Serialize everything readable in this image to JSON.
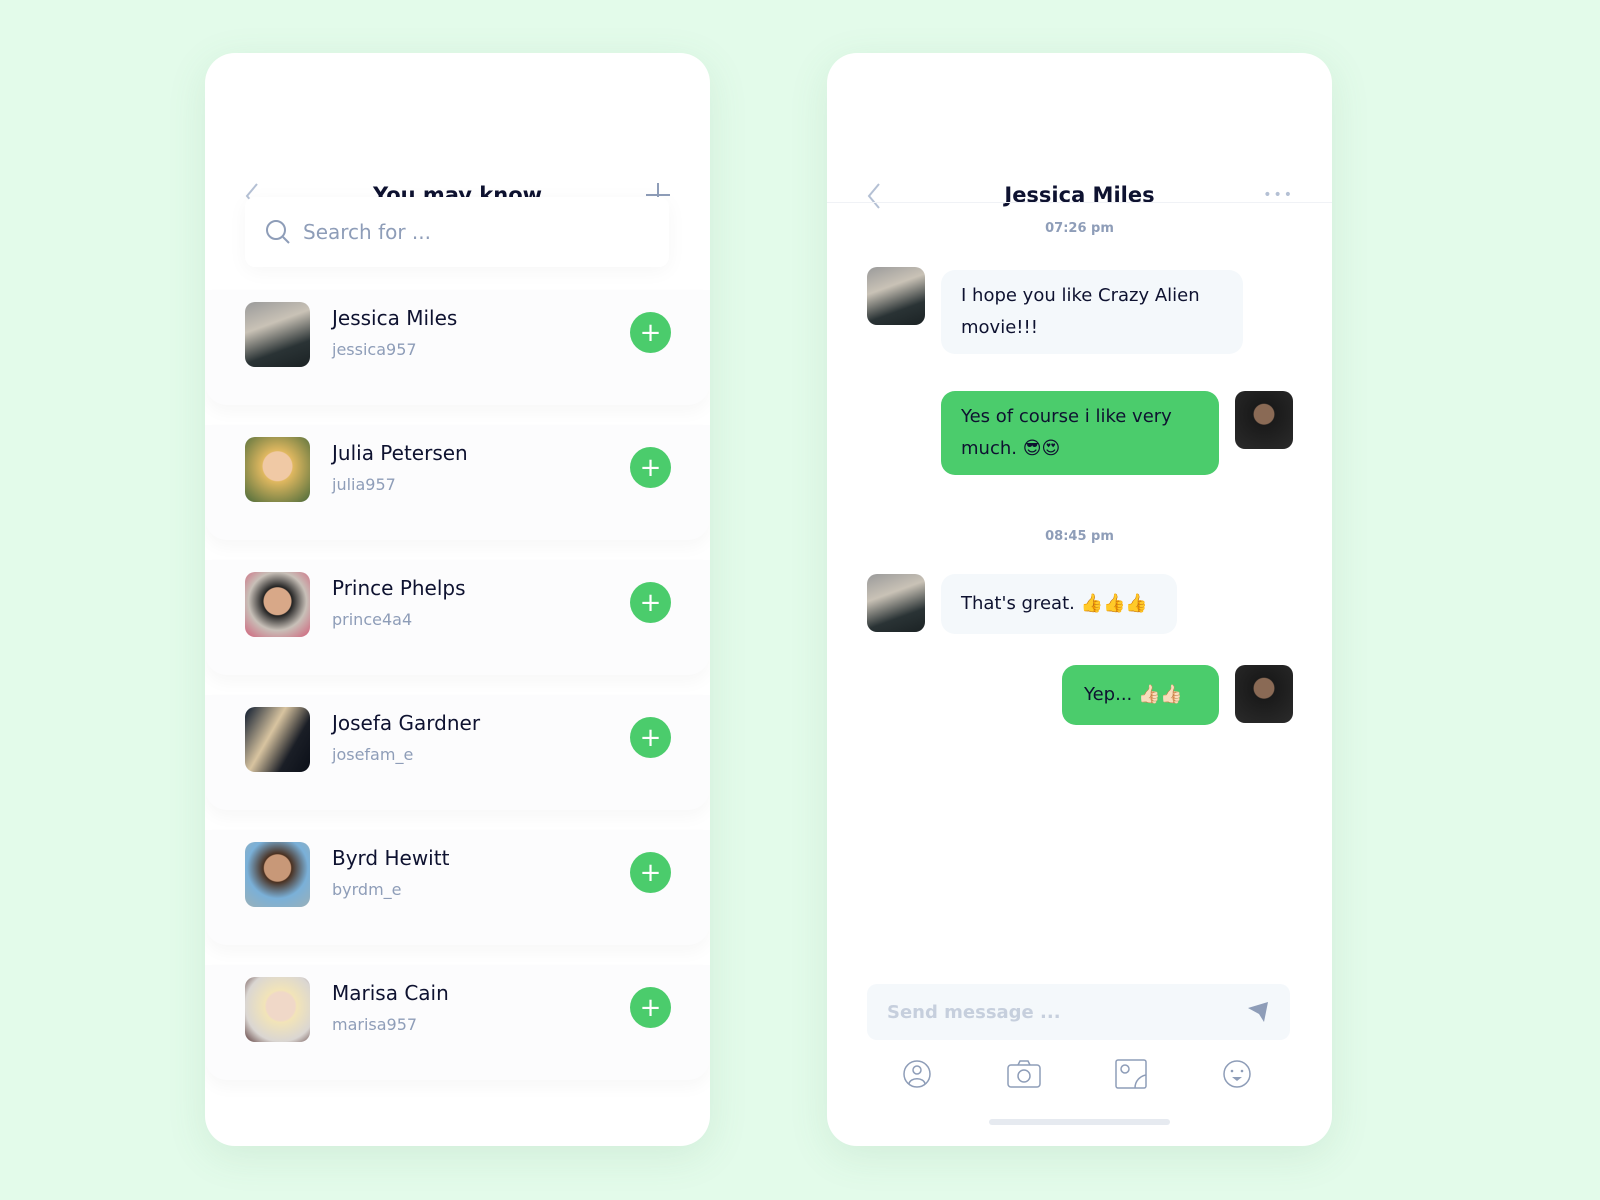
{
  "contacts_screen": {
    "title": "You may know",
    "search_placeholder": "Search for ...",
    "contacts": [
      {
        "name": "Jessica Miles",
        "username": "jessica957"
      },
      {
        "name": "Julia Petersen",
        "username": "julia957"
      },
      {
        "name": "Prince Phelps",
        "username": "prince4a4"
      },
      {
        "name": "Josefa Gardner",
        "username": "josefam_e"
      },
      {
        "name": "Byrd Hewitt",
        "username": "byrdm_e"
      },
      {
        "name": "Marisa Cain",
        "username": "marisa957"
      }
    ],
    "add_label": "+"
  },
  "chat_screen": {
    "title": "Jessica Miles",
    "more_label": "•••",
    "timestamps": [
      "07:26 pm",
      "08:45 pm"
    ],
    "messages": [
      {
        "from": "them",
        "text": "I hope you like Crazy Alien movie!!!"
      },
      {
        "from": "me",
        "text": "Yes of course i like very much. 😎😍"
      },
      {
        "from": "them",
        "text": "That's great.  👍👍👍"
      },
      {
        "from": "me",
        "text": "Yep...  👍🏻👍🏻"
      }
    ],
    "input_placeholder": "Send message ...",
    "toolbar_icons": [
      "contact-icon",
      "camera-icon",
      "image-icon",
      "emoji-icon"
    ]
  },
  "colors": {
    "background": "#e3fbea",
    "accent": "#4bcc6c",
    "muted": "#8e9db8"
  }
}
